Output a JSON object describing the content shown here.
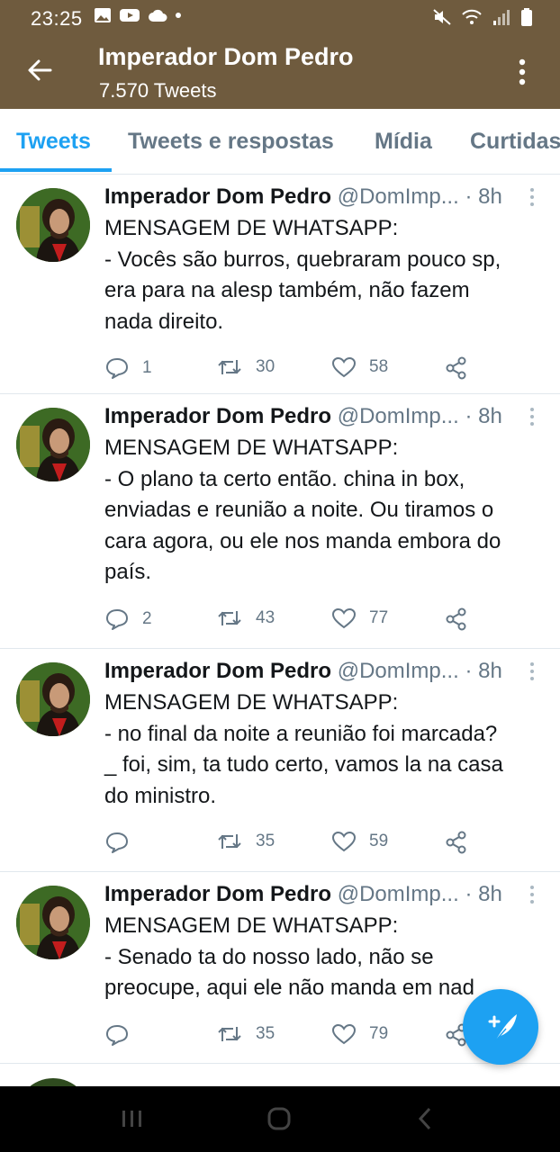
{
  "status_bar": {
    "time": "23:25"
  },
  "header": {
    "title": "Imperador Dom Pedro",
    "subtitle": "7.570 Tweets"
  },
  "tabs": [
    {
      "label": "Tweets"
    },
    {
      "label": "Tweets e respostas"
    },
    {
      "label": "Mídia"
    },
    {
      "label": "Curtidas"
    }
  ],
  "tweets": [
    {
      "name": "Imperador Dom Pedro",
      "handle": "@DomImp...",
      "time": "· 8h",
      "lines": [
        "MENSAGEM DE WHATSAPP:",
        "- Vocês são burros, quebraram pouco sp,",
        "era para na alesp também, não fazem",
        "nada direito."
      ],
      "replies": "1",
      "retweets": "30",
      "likes": "58"
    },
    {
      "name": "Imperador Dom Pedro",
      "handle": "@DomImp...",
      "time": "· 8h",
      "lines": [
        "MENSAGEM DE WHATSAPP:",
        "- O plano ta certo então. china in box,",
        "enviadas e reunião a noite. Ou tiramos o",
        "cara agora, ou ele nos manda embora do",
        "país."
      ],
      "replies": "2",
      "retweets": "43",
      "likes": "77"
    },
    {
      "name": "Imperador Dom Pedro",
      "handle": "@DomImp...",
      "time": "· 8h",
      "lines": [
        "MENSAGEM DE WHATSAPP:",
        "- no final da noite a reunião foi marcada?",
        "_ foi, sim, ta tudo certo, vamos la na casa",
        "do ministro."
      ],
      "replies": "",
      "retweets": "35",
      "likes": "59"
    },
    {
      "name": "Imperador Dom Pedro",
      "handle": "@DomImp...",
      "time": "· 8h",
      "lines": [
        "MENSAGEM DE WHATSAPP:",
        "- Senado ta do nosso lado, não se",
        "preocupe, aqui ele não manda em nad"
      ],
      "replies": "",
      "retweets": "35",
      "likes": "79"
    }
  ],
  "colors": {
    "header_bg": "#6f5b3e",
    "accent": "#1da1f2",
    "muted": "#657786"
  },
  "icons": {
    "back": "arrow-left-icon",
    "more": "kebab-menu-icon",
    "reply": "speech-bubble-icon",
    "retweet": "retweet-icon",
    "like": "heart-icon",
    "share": "share-icon",
    "compose": "feather-plus-icon"
  }
}
